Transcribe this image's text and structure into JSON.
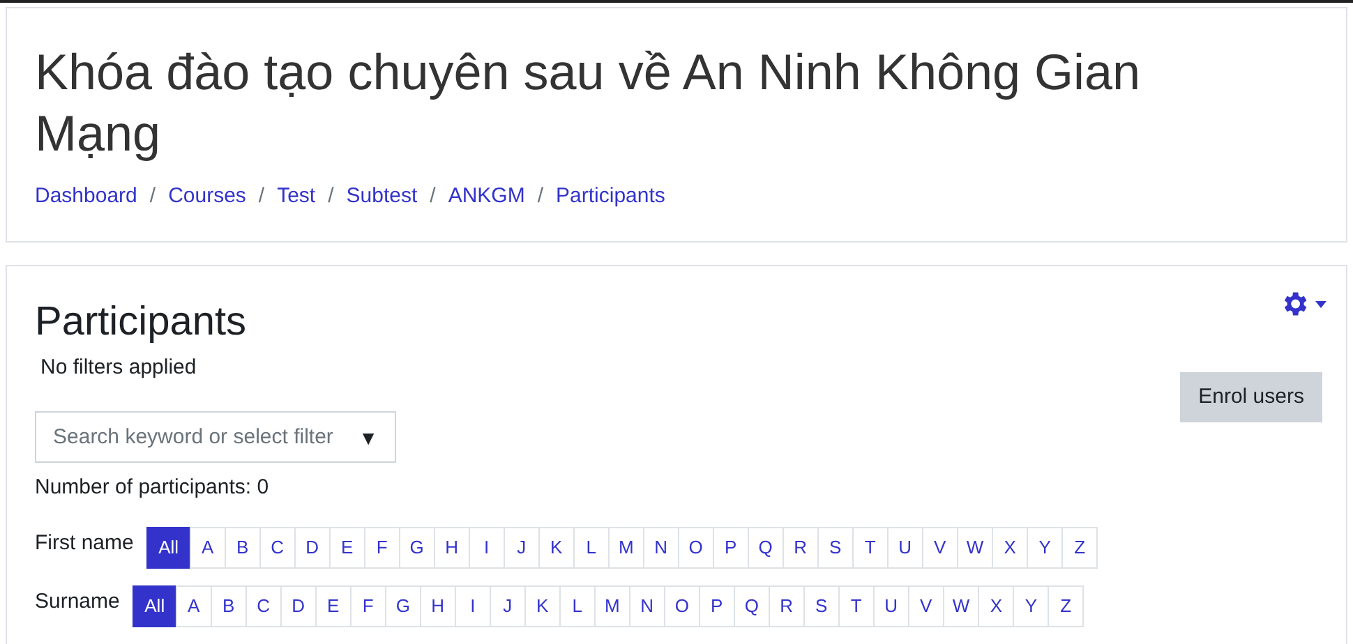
{
  "header": {
    "title": "Khóa đào tạo chuyên sau về An Ninh Không Gian Mạng",
    "breadcrumb": [
      "Dashboard",
      "Courses",
      "Test",
      "Subtest",
      "ANKGM",
      "Participants"
    ],
    "separator": "/"
  },
  "participants": {
    "heading": "Participants",
    "filter_status": "No filters applied",
    "enrol_button": "Enrol users",
    "search": {
      "placeholder": "Search keyword or select filter",
      "caret": "▼"
    },
    "count": "Number of participants: 0",
    "initials_bars": [
      {
        "label": "First name",
        "letters": [
          {
            "label": "All",
            "selected": true
          },
          {
            "label": "A",
            "selected": false
          },
          {
            "label": "B",
            "selected": false
          },
          {
            "label": "C",
            "selected": false
          },
          {
            "label": "D",
            "selected": false
          },
          {
            "label": "E",
            "selected": false
          },
          {
            "label": "F",
            "selected": false
          },
          {
            "label": "G",
            "selected": false
          },
          {
            "label": "H",
            "selected": false
          },
          {
            "label": "I",
            "selected": false
          },
          {
            "label": "J",
            "selected": false
          },
          {
            "label": "K",
            "selected": false
          },
          {
            "label": "L",
            "selected": false
          },
          {
            "label": "M",
            "selected": false
          },
          {
            "label": "N",
            "selected": false
          },
          {
            "label": "O",
            "selected": false
          },
          {
            "label": "P",
            "selected": false
          },
          {
            "label": "Q",
            "selected": false
          },
          {
            "label": "R",
            "selected": false
          },
          {
            "label": "S",
            "selected": false
          },
          {
            "label": "T",
            "selected": false
          },
          {
            "label": "U",
            "selected": false
          },
          {
            "label": "V",
            "selected": false
          },
          {
            "label": "W",
            "selected": false
          },
          {
            "label": "X",
            "selected": false
          },
          {
            "label": "Y",
            "selected": false
          },
          {
            "label": "Z",
            "selected": false
          }
        ]
      },
      {
        "label": "Surname",
        "letters": [
          {
            "label": "All",
            "selected": true
          },
          {
            "label": "A",
            "selected": false
          },
          {
            "label": "B",
            "selected": false
          },
          {
            "label": "C",
            "selected": false
          },
          {
            "label": "D",
            "selected": false
          },
          {
            "label": "E",
            "selected": false
          },
          {
            "label": "F",
            "selected": false
          },
          {
            "label": "G",
            "selected": false
          },
          {
            "label": "H",
            "selected": false
          },
          {
            "label": "I",
            "selected": false
          },
          {
            "label": "J",
            "selected": false
          },
          {
            "label": "K",
            "selected": false
          },
          {
            "label": "L",
            "selected": false
          },
          {
            "label": "M",
            "selected": false
          },
          {
            "label": "N",
            "selected": false
          },
          {
            "label": "O",
            "selected": false
          },
          {
            "label": "P",
            "selected": false
          },
          {
            "label": "Q",
            "selected": false
          },
          {
            "label": "R",
            "selected": false
          },
          {
            "label": "S",
            "selected": false
          },
          {
            "label": "T",
            "selected": false
          },
          {
            "label": "U",
            "selected": false
          },
          {
            "label": "V",
            "selected": false
          },
          {
            "label": "W",
            "selected": false
          },
          {
            "label": "X",
            "selected": false
          },
          {
            "label": "Y",
            "selected": false
          },
          {
            "label": "Z",
            "selected": false
          }
        ]
      }
    ]
  }
}
